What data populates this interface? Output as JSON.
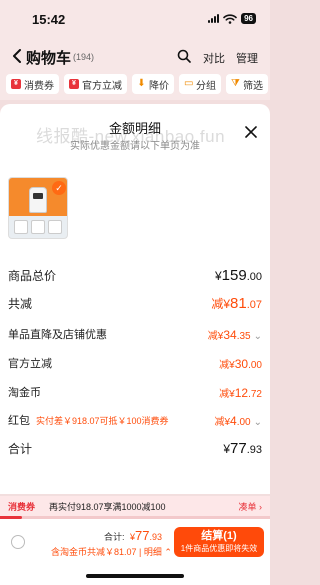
{
  "status_bar": {
    "time": "15:42",
    "battery": "96"
  },
  "header": {
    "back_icon": "chevron-left-icon",
    "title": "购物车",
    "count": "(194)",
    "search_icon": "search-icon",
    "compare": "对比",
    "manage": "管理"
  },
  "filters": [
    {
      "label": "消费券",
      "icon": "red-tag-icon",
      "icon_text": "¥"
    },
    {
      "label": "官方立减",
      "icon": "red-tag-icon",
      "icon_text": "¥"
    },
    {
      "label": "降价",
      "icon": "arrow-down-icon",
      "icon_text": "⬇"
    },
    {
      "label": "分组",
      "icon": "folder-icon",
      "icon_text": "▭"
    },
    {
      "label": "筛选",
      "icon": "filter-icon",
      "icon_text": "⧩"
    }
  ],
  "sheet": {
    "title": "金额明细",
    "subtitle": "实际优惠金额请以下单页为准",
    "watermark": "线报酷-new.xianbao.fun",
    "close_icon": "close-icon",
    "product_image": "product-thumbnail",
    "rows": {
      "goods_total": {
        "label": "商品总价",
        "curr": "¥",
        "int": "159",
        "dec": ".00"
      },
      "total_discount": {
        "label": "共减",
        "prefix": "减¥",
        "int": "81",
        "dec": ".07"
      },
      "direct_discount": {
        "label": "单品直降及店铺优惠",
        "prefix": "减¥",
        "int": "34",
        "dec": ".35"
      },
      "official_discount": {
        "label": "官方立减",
        "prefix": "减¥",
        "int": "30",
        "dec": ".00"
      },
      "taojinbi": {
        "label": "淘金币",
        "prefix": "减¥",
        "int": "12",
        "dec": ".72"
      },
      "redpack": {
        "label": "红包",
        "note": "实付差￥918.07可抵￥100消费券",
        "prefix": "减¥",
        "int": "4",
        "dec": ".00"
      },
      "total": {
        "label": "合计",
        "curr": "¥",
        "int": "77",
        "dec": ".93"
      }
    }
  },
  "promo": {
    "tag": "消费券",
    "text": "再实付918.07享满1000减100",
    "link": "凑单 ›",
    "progress": 0.08
  },
  "bottom_bar": {
    "total_label": "合计:",
    "total_curr": "¥",
    "total_int": "77",
    "total_dec": ".93",
    "breakdown": "含淘金币共减￥81.07 | 明细 ⌃",
    "checkout": "结算(1)",
    "checkout_sub": "1件商品优惠即将失效"
  }
}
